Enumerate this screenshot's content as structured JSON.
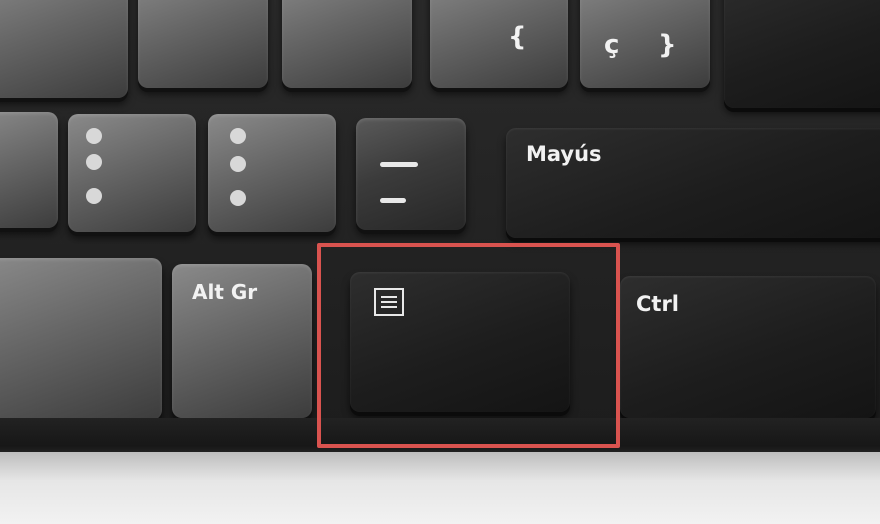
{
  "keys": {
    "shift_label": "Mayús",
    "alt_gr_label": "Alt Gr",
    "ctrl_label": "Ctrl",
    "c_cedilla_label": "ç",
    "brace_label": "}",
    "open_brace_label": "{",
    "menu_key_icon": "menu-icon"
  },
  "colors": {
    "highlight_border": "#d9534f",
    "key_dark": "#1d1d1d",
    "key_light": "#666666",
    "label": "#f2f2f2"
  }
}
